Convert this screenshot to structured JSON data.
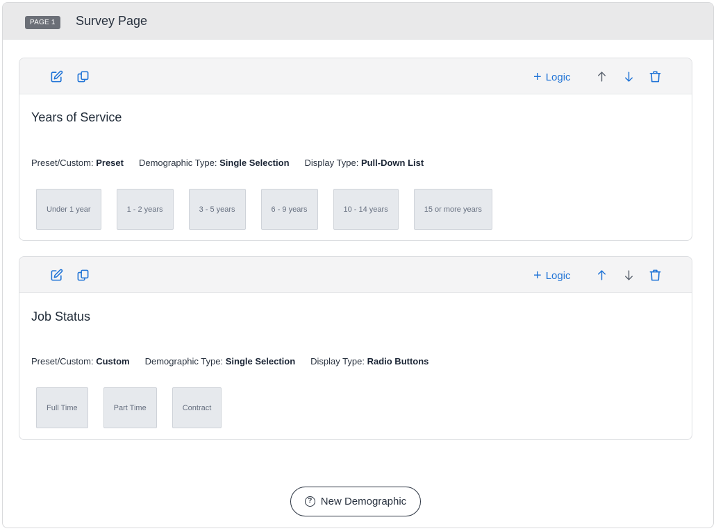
{
  "page": {
    "badge": "PAGE 1",
    "title": "Survey Page"
  },
  "toolbar": {
    "logic_label": "Logic",
    "icons": [
      "edit-icon",
      "copy-icon",
      "arrow-up-icon",
      "arrow-down-icon",
      "trash-icon"
    ]
  },
  "colors": {
    "accent": "#1f73d6",
    "header_bg": "#e9e9ea",
    "toolbar_bg": "#f4f4f5",
    "option_bg": "#e6e9ed"
  },
  "cards": [
    {
      "title": "Years of Service",
      "preset_label": "Preset/Custom:",
      "preset_value": "Preset",
      "type_label": "Demographic Type:",
      "type_value": "Single Selection",
      "display_label": "Display Type:",
      "display_value": "Pull-Down List",
      "options": [
        "Under 1 year",
        "1 - 2 years",
        "3 - 5 years",
        "6 - 9 years",
        "10 - 14 years",
        "15 or more years"
      ]
    },
    {
      "title": "Job Status",
      "preset_label": "Preset/Custom:",
      "preset_value": "Custom",
      "type_label": "Demographic Type:",
      "type_value": "Single Selection",
      "display_label": "Display Type:",
      "display_value": "Radio Buttons",
      "options": [
        "Full Time",
        "Part Time",
        "Contract"
      ]
    }
  ],
  "footer": {
    "new_demographic_label": "New Demographic"
  }
}
